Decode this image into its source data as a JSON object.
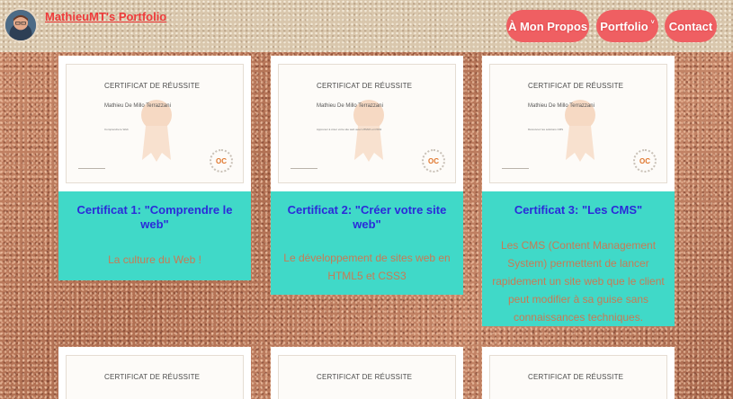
{
  "header": {
    "brand": "MathieuMT's Portfolio",
    "nav": [
      {
        "label": "À Mon Propos"
      },
      {
        "label": "Portfolio",
        "chevron": "˅"
      },
      {
        "label": "Contact"
      }
    ]
  },
  "certificates": [
    {
      "image": {
        "heading": "CERTIFICAT DE RÉUSSITE",
        "recipient": "Mathieu De Millo Terrazzani",
        "course": "Comprendre le Web",
        "logo": "OC"
      },
      "title": "Certificat 1: \"Comprendre le web\"",
      "text": "La culture du Web !"
    },
    {
      "image": {
        "heading": "CERTIFICAT DE RÉUSSITE",
        "recipient": "Mathieu De Millo Terrazzani",
        "course": "Apprenez à créer votre site web avec HTML5 et CSS3",
        "logo": "OC"
      },
      "title": "Certificat 2: \"Créer votre site web\"",
      "text": "Le développement de sites web en HTML5 et CSS3"
    },
    {
      "image": {
        "heading": "CERTIFICAT DE RÉUSSITE",
        "recipient": "Mathieu De Millo Terrazzani",
        "course": "Découvrez les solutions CMS",
        "logo": "OC"
      },
      "title": "Certificat 3: \"Les CMS\"",
      "text": "Les CMS (Content Management System) permettent de lancer rapidement un site web que le client peut modifier à sa guise sans connaissances techniques."
    },
    {
      "image": {
        "heading": "CERTIFICAT DE RÉUSSITE"
      }
    },
    {
      "image": {
        "heading": "CERTIFICAT DE RÉUSSITE"
      }
    },
    {
      "image": {
        "heading": "CERTIFICAT DE RÉUSSITE"
      }
    }
  ],
  "colors": {
    "panel": "#40d9c8",
    "panel_title": "#2b2bd9",
    "panel_text": "#c87a54",
    "nav_button": "#ef5f62",
    "brand": "#ee3b3b"
  }
}
